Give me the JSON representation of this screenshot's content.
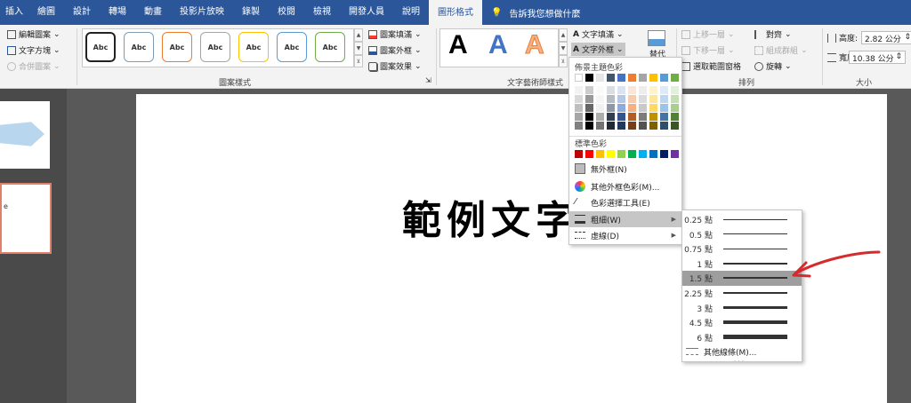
{
  "tabs": [
    "插入",
    "繪圖",
    "設計",
    "轉場",
    "動畫",
    "投影片放映",
    "錄製",
    "校閱",
    "檢視",
    "開發人員",
    "說明",
    "圖形格式"
  ],
  "tell_me": "告訴我您想做什麼",
  "insert_shapes": {
    "edit_shape": "編輯圖案",
    "text_box": "文字方塊",
    "merge_shapes": "合併圖案"
  },
  "shape_styles": {
    "label": "圖案樣式",
    "swatches": [
      "Abc",
      "Abc",
      "Abc",
      "Abc",
      "Abc",
      "Abc",
      "Abc"
    ],
    "fill": "圖案填滿",
    "outline": "圖案外框",
    "effects": "圖案效果",
    "swatch_colors": [
      "#222222",
      "#7f9db5",
      "#ed7d31",
      "#a5a5a5",
      "#ffc000",
      "#5b9bd5",
      "#70ad47"
    ]
  },
  "wordart": {
    "label": "文字藝術師樣式",
    "letter": "A",
    "text_fill": "文字填滿",
    "text_outline": "文字外框"
  },
  "accessibility": {
    "alt_text": "替代"
  },
  "arrange": {
    "label": "排列",
    "bring_forward": "上移一層",
    "send_backward": "下移一層",
    "selection_pane": "選取範圍窗格",
    "align": "對齊",
    "group": "組成群組",
    "rotate": "旋轉"
  },
  "size": {
    "label": "大小",
    "height_label": "高度:",
    "height": "2.82 公分",
    "width_label": "寬度:",
    "width": "10.38 公分"
  },
  "slide": {
    "text": "範例文字"
  },
  "outline_menu": {
    "theme_colors_header": "佈景主題色彩",
    "standard_colors_header": "標準色彩",
    "no_outline": "無外框(N)",
    "more_colors": "其他外框色彩(M)...",
    "eyedropper": "色彩選擇工具(E)",
    "weight": "粗細(W)",
    "dashes": "虛線(D)",
    "theme_top": [
      "#ffffff",
      "#000000",
      "#e7e6e6",
      "#44546a",
      "#4472c4",
      "#ed7d31",
      "#a5a5a5",
      "#ffc000",
      "#5b9bd5",
      "#70ad47"
    ],
    "standard": [
      "#c00000",
      "#ff0000",
      "#ffc000",
      "#ffff00",
      "#92d050",
      "#00b050",
      "#00b0f0",
      "#0070c0",
      "#002060",
      "#7030a0"
    ]
  },
  "weight_menu": {
    "items": [
      "0.25 點",
      "0.5 點",
      "0.75 點",
      "1 點",
      "1.5 點",
      "2.25 點",
      "3 點",
      "4.5 點",
      "6 點"
    ],
    "selected": "1.5 點",
    "more_lines": "其他線條(M)..."
  },
  "annotation": {
    "arrow_color": "#d62b2b"
  }
}
